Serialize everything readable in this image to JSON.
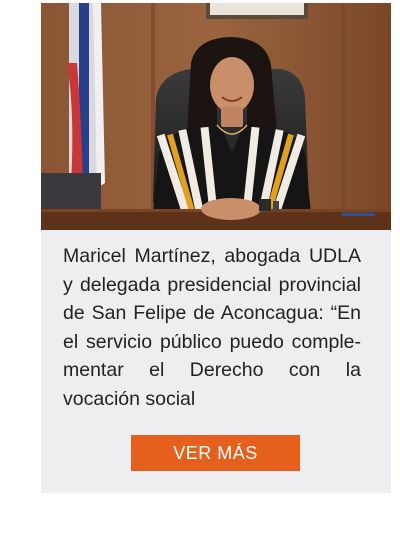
{
  "article": {
    "photo_name": "woman-at-desk-photo",
    "caption": "Maricel Martínez, abogada UDLA y delegada presidencial provincial de San Felipe de Aconcagua: “En el servicio público puedo comple-mentar el Derecho con la vocación social",
    "button_label": "VER MÁS"
  },
  "colors": {
    "card_background": "#eeeef0",
    "button_background": "#e5601c",
    "button_text": "#ffffff",
    "caption_text": "#222222"
  }
}
